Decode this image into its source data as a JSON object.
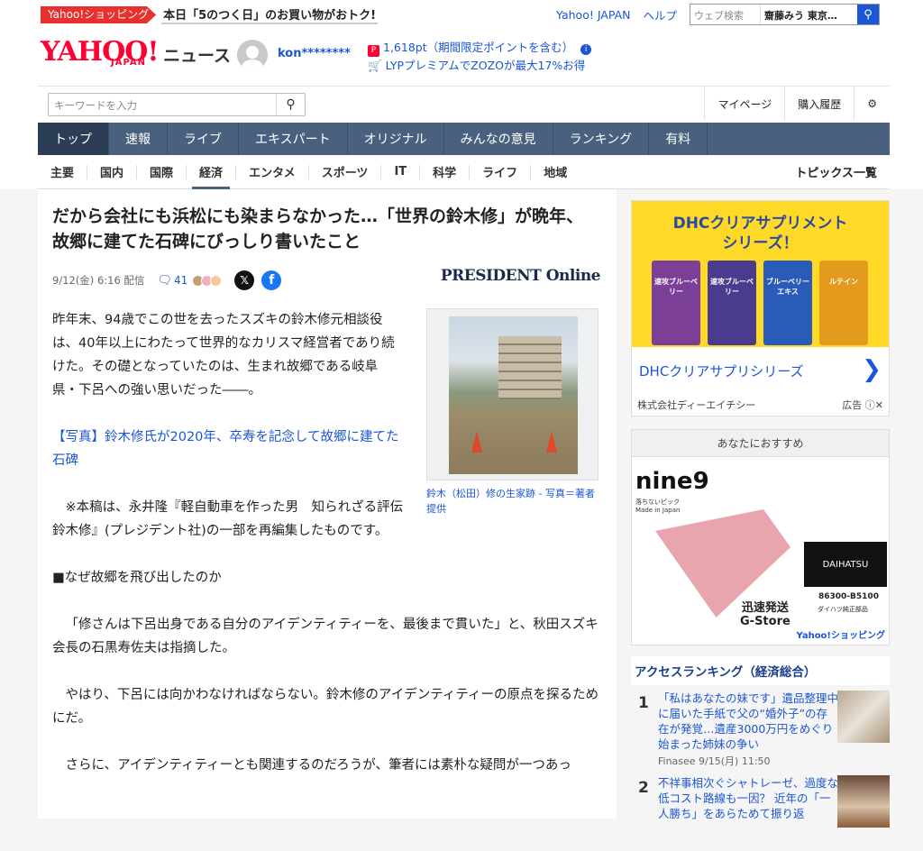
{
  "promo": {
    "tag": "Yahoo!ショッピング",
    "text": "本日「5のつく日」のお買い物がおトク!"
  },
  "toplinks": {
    "yahoo_japan": "Yahoo! JAPAN",
    "help": "ヘルプ",
    "search_placeholder": "ウェブ検索",
    "search_chip": "齋藤みう 東京…"
  },
  "logo": {
    "main": "YAHOO!",
    "sub": "JAPAN",
    "service": "ニュース"
  },
  "user": {
    "name": "kon********",
    "points": "1,618pt（期間限定ポイントを含む）",
    "promo": "LYPプレミアムでZOZOが最大17%お得"
  },
  "search": {
    "placeholder": "キーワードを入力"
  },
  "mylinks": {
    "mypage": "マイページ",
    "history": "購入履歴"
  },
  "gnav": [
    "トップ",
    "速報",
    "ライブ",
    "エキスパート",
    "オリジナル",
    "みんなの意見",
    "ランキング",
    "有料"
  ],
  "subnav": [
    "主要",
    "国内",
    "国際",
    "経済",
    "エンタメ",
    "スポーツ",
    "IT",
    "科学",
    "ライフ",
    "地域"
  ],
  "subnav_topics": "トピックス一覧",
  "article": {
    "headline": "だから会社にも浜松にも染まらなかった…「世界の鈴木修」が晩年、故郷に建てた石碑にびっしり書いたこと",
    "date": "9/12(金) 6:16 配信",
    "comments": "41",
    "publisher": "PRESIDENT Online",
    "p1": "昨年末、94歳でこの世を去ったスズキの鈴木修元相談役は、40年以上にわたって世界的なカリスマ経営者であり続けた。その礎となっていたのは、生まれ故郷である岐阜県・下呂への強い思いだった――。",
    "link": "【写真】鈴木修氏が2020年、卒寿を記念して故郷に建てた石碑",
    "note": "※本稿は、永井隆『軽自動車を作った男　知られざる評伝　鈴木修』(プレジデント社)の一部を再編集したものです。",
    "section": "■なぜ故郷を飛び出したのか",
    "p2": "「修さんは下呂出身である自分のアイデンティティーを、最後まで貫いた」と、秋田スズキ会長の石黒寿佐夫は指摘した。",
    "p3": "やはり、下呂には向かわなければならない。鈴木修のアイデンティティーの原点を探るためにだ。",
    "p4": "さらに、アイデンティティーとも関連するのだろうが、筆者には素朴な疑問が一つあっ",
    "photo_caption": "鈴木（松田）修の生家跡 - 写真＝著者提供"
  },
  "ad1": {
    "title_line1": "DHCクリアサプリメント",
    "title_line2": "シリーズ！",
    "packs": [
      "速攻ブルーベリー",
      "速攻ブルーベリー",
      "ブルーベリーエキス",
      "ルテイン"
    ],
    "link": "DHCクリアサプリシリーズ",
    "company": "株式会社ディーエイチシー",
    "label": "広告"
  },
  "rec": {
    "header": "あなたにおすすめ",
    "brand": "nine9",
    "brand_sub1": "落ちないピック",
    "brand_sub2": "Made in Japan",
    "daihatsu": "DAIHATSU",
    "code": "86300-B5100",
    "code_sub": "ダイハツ純正部品",
    "shipping": "迅速発送",
    "store": "G-Store",
    "shop": "Yahoo!ショッピング"
  },
  "ranking": {
    "title": "アクセスランキング（経済総合）",
    "items": [
      {
        "num": "1",
        "text": "「私はあなたの妹です」遺品整理中に届いた手紙で父の“婚外子”の存在が発覚…遺産3000万円をめぐり始まった姉妹の争い",
        "src": "Finasee 9/15(月) 11:50"
      },
      {
        "num": "2",
        "text": "不祥事相次ぐシャトレーゼ、過度な低コスト路線も一因？ 近年の「一人勝ち」をあらためて振り返",
        "src": ""
      }
    ]
  },
  "colors": {
    "nav": "#49617e",
    "link": "#1a56d6",
    "brand_red": "#ff0033"
  }
}
